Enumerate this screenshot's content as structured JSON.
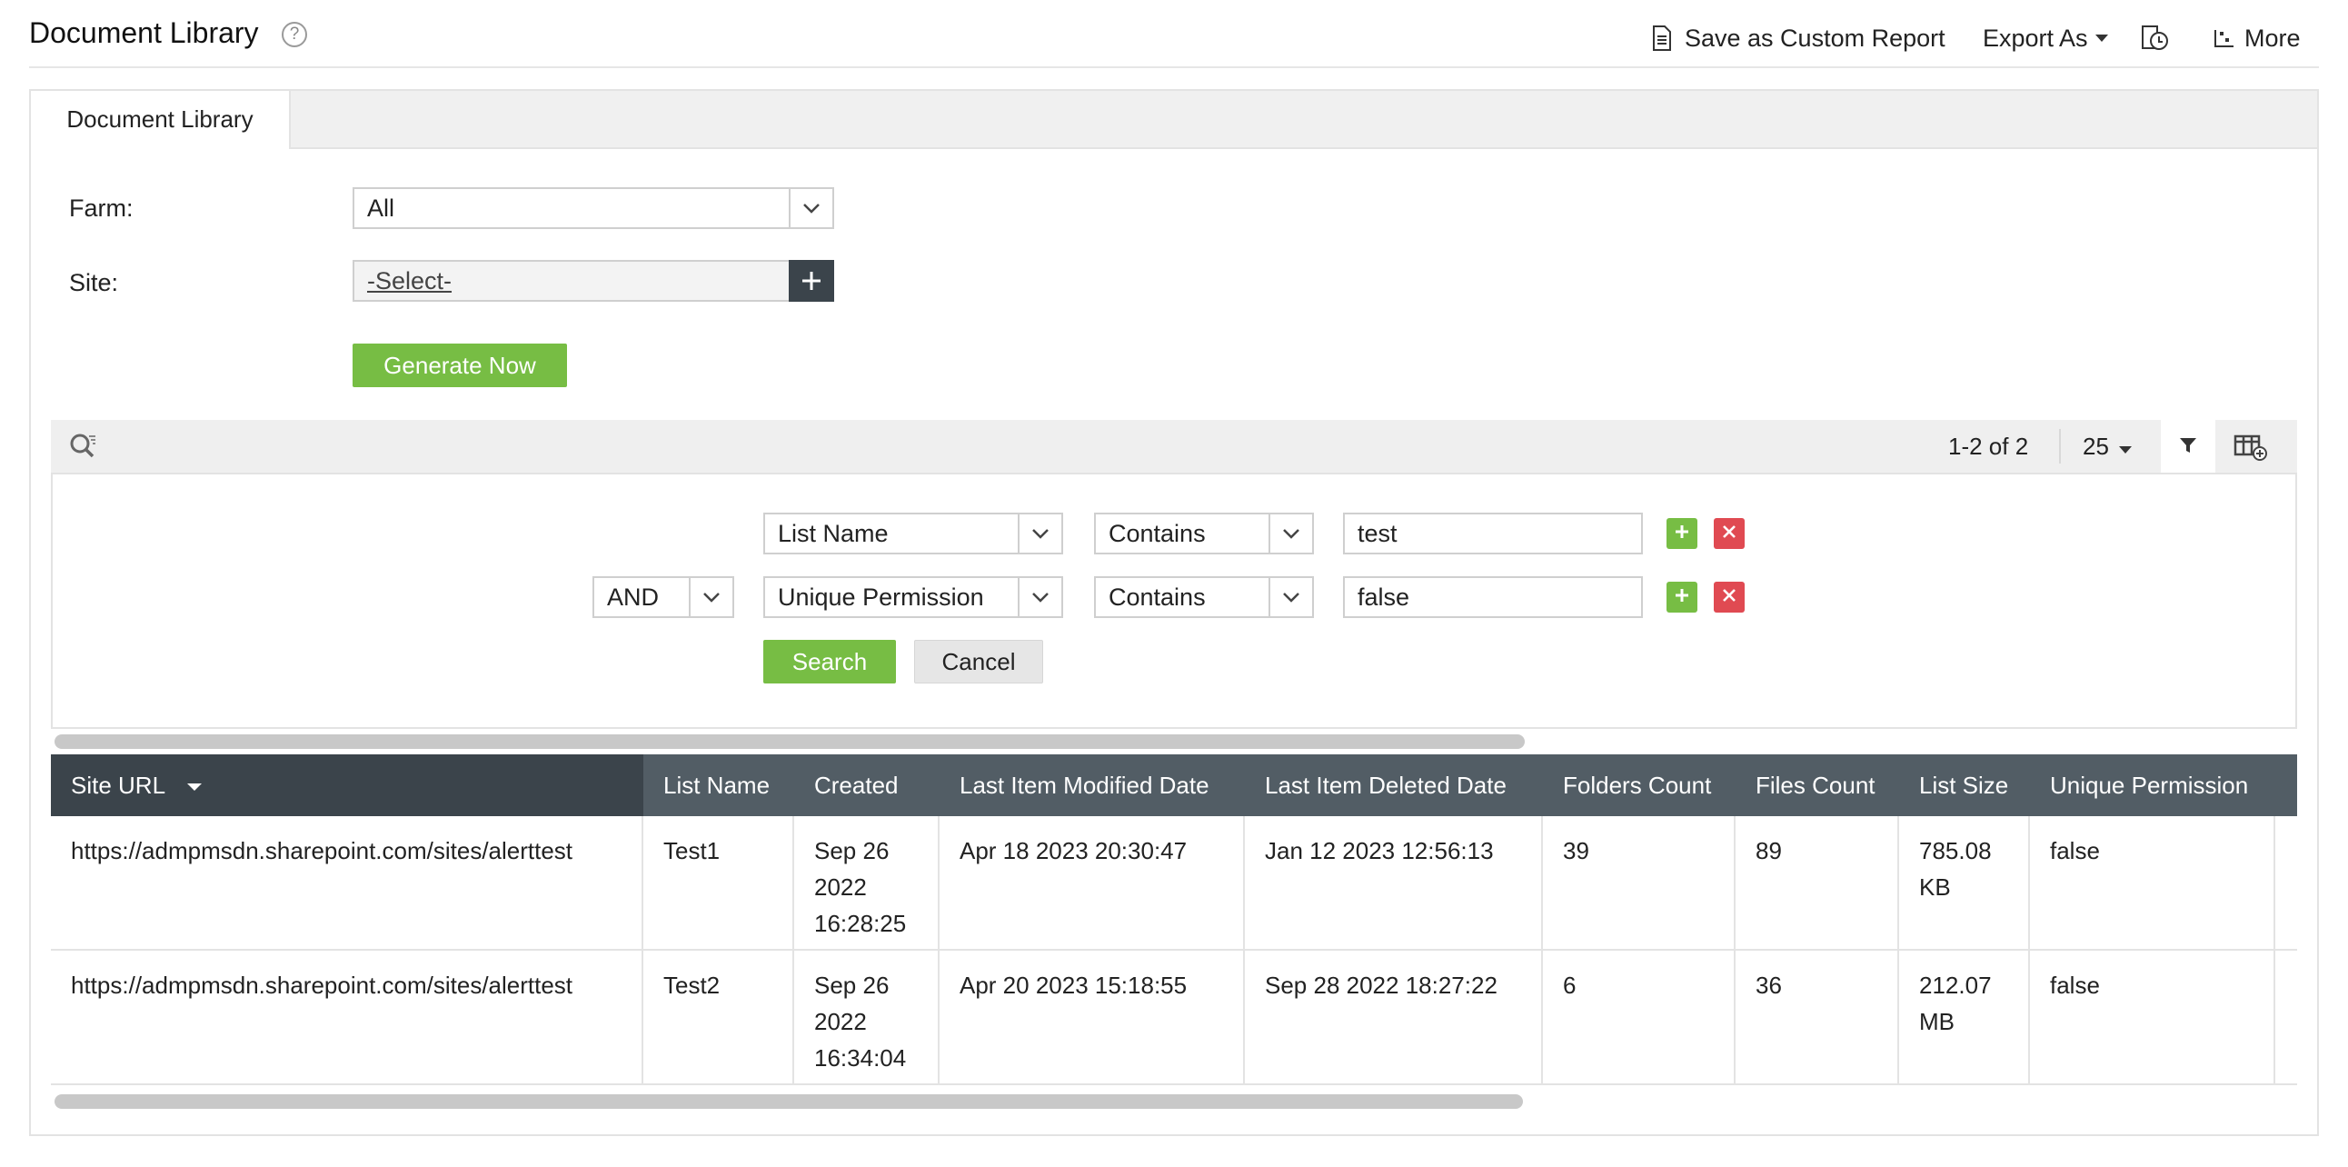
{
  "header": {
    "title": "Document Library",
    "save_custom_report": "Save as Custom Report",
    "export_as": "Export As",
    "more": "More"
  },
  "tabs": [
    "Document Library"
  ],
  "form": {
    "farm_label": "Farm:",
    "farm_value": "All",
    "site_label": "Site:",
    "site_value": "-Select-",
    "generate_button": "Generate Now"
  },
  "toolbar": {
    "pagination": "1-2 of 2",
    "page_size": "25"
  },
  "filters": [
    {
      "conjunction": "",
      "field": "List Name",
      "operator": "Contains",
      "value": "test"
    },
    {
      "conjunction": "AND",
      "field": "Unique Permission",
      "operator": "Contains",
      "value": "false"
    }
  ],
  "filter_actions": {
    "search": "Search",
    "cancel": "Cancel"
  },
  "table": {
    "columns": [
      "Site URL",
      "List Name",
      "Created",
      "Last Item Modified Date",
      "Last Item Deleted Date",
      "Folders Count",
      "Files Count",
      "List Size",
      "Unique Permission"
    ],
    "rows": [
      {
        "site_url": "https://admpmsdn.sharepoint.com/sites/alerttest",
        "list_name": "Test1",
        "created": [
          "Sep 26",
          "2022",
          "16:28:25"
        ],
        "last_modified": "Apr 18 2023 20:30:47",
        "last_deleted": "Jan 12 2023 12:56:13",
        "folders_count": "39",
        "files_count": "89",
        "list_size": [
          "785.08",
          "KB"
        ],
        "unique_permission": "false"
      },
      {
        "site_url": "https://admpmsdn.sharepoint.com/sites/alerttest",
        "list_name": "Test2",
        "created": [
          "Sep 26",
          "2022",
          "16:34:04"
        ],
        "last_modified": "Apr 20 2023 15:18:55",
        "last_deleted": "Sep 28 2022 18:27:22",
        "folders_count": "6",
        "files_count": "36",
        "list_size": [
          "212.07",
          "MB"
        ],
        "unique_permission": "false"
      }
    ]
  },
  "colors": {
    "accent_green": "#77bd44",
    "delete_red": "#e04a52",
    "header_dark": "#3b444b",
    "header_mid": "#525d65"
  }
}
